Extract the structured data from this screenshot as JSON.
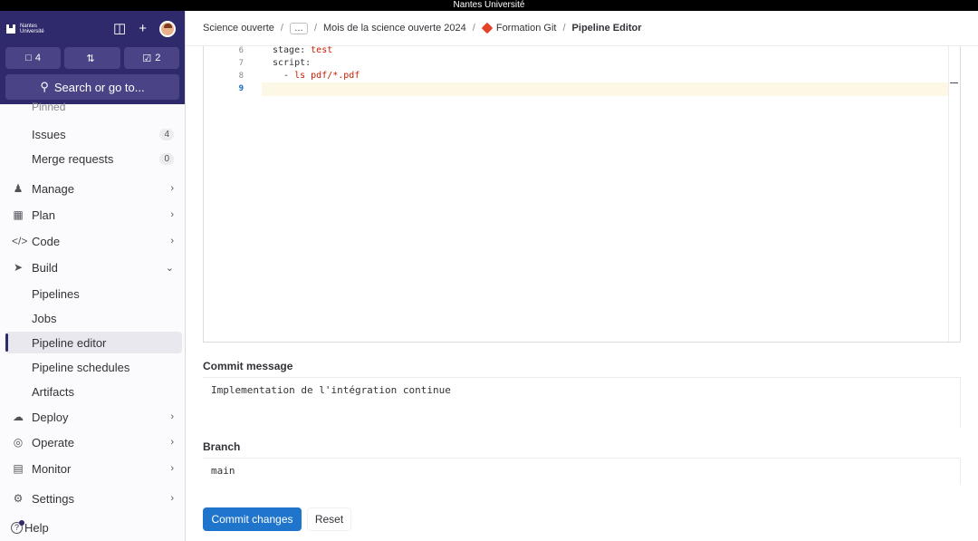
{
  "window": {
    "title": "Nantes Université"
  },
  "sidebar": {
    "logo": {
      "line1": "Nantes",
      "line2": "Université"
    },
    "counters": [
      {
        "icon": "issues-icon",
        "value": "4"
      },
      {
        "icon": "merge-request-icon",
        "value": ""
      },
      {
        "icon": "todo-icon",
        "value": "2"
      }
    ],
    "search_label": "Search or go to...",
    "pinned_label": "Pinned",
    "items": [
      {
        "label": "Issues",
        "badge": "4"
      },
      {
        "label": "Merge requests",
        "badge": "0"
      },
      {
        "label": "Manage",
        "icon": "users-icon"
      },
      {
        "label": "Plan",
        "icon": "calendar-icon"
      },
      {
        "label": "Code",
        "icon": "code-icon"
      },
      {
        "label": "Build",
        "icon": "rocket-icon"
      },
      {
        "label": "Pipelines"
      },
      {
        "label": "Jobs"
      },
      {
        "label": "Pipeline editor",
        "active": true
      },
      {
        "label": "Pipeline schedules"
      },
      {
        "label": "Artifacts"
      },
      {
        "label": "Deploy",
        "icon": "deploy-icon"
      },
      {
        "label": "Operate",
        "icon": "operate-icon"
      },
      {
        "label": "Monitor",
        "icon": "monitor-icon"
      },
      {
        "label": "Settings",
        "icon": "gear-icon"
      }
    ],
    "help_label": "Help"
  },
  "breadcrumb": {
    "items": [
      "Science ouverte",
      "…",
      "Mois de la science ouverte 2024",
      "Formation Git",
      "Pipeline Editor"
    ]
  },
  "editor": {
    "lines": [
      {
        "num": "6",
        "key": "stage: ",
        "value": "test"
      },
      {
        "num": "7",
        "key": "script:",
        "value": ""
      },
      {
        "num": "8",
        "key": "  - ",
        "value": "ls pdf/*.pdf"
      },
      {
        "num": "9",
        "key": "",
        "value": ""
      }
    ]
  },
  "commit": {
    "message_label": "Commit message",
    "message_value": "Implementation de l'intégration continue",
    "branch_label": "Branch",
    "branch_value": "main",
    "commit_button": "Commit changes",
    "reset_button": "Reset"
  },
  "colors": {
    "sidebar_top": "#2f2a6b",
    "primary": "#1f75cb"
  }
}
